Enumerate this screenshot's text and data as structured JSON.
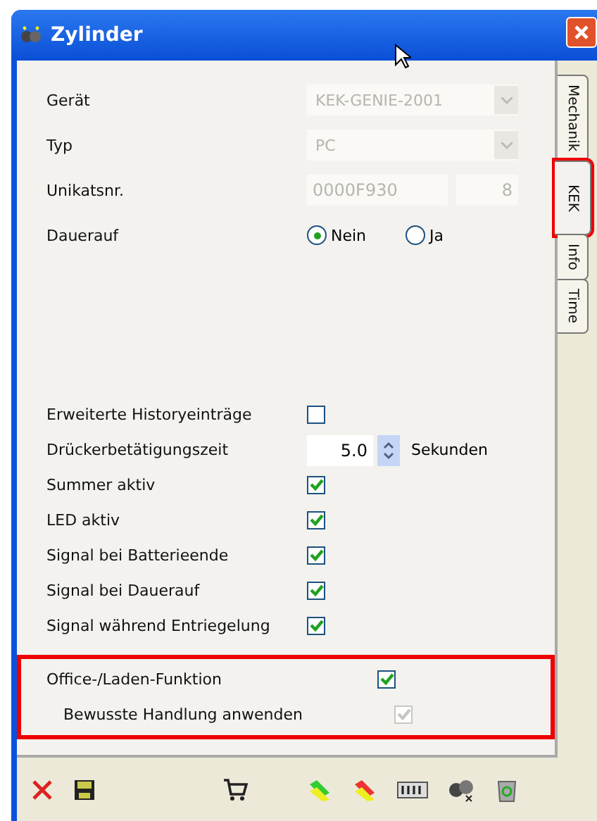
{
  "window": {
    "title": "Zylinder"
  },
  "tabs": [
    {
      "label": "Mechanik",
      "selected": false,
      "highlighted": false
    },
    {
      "label": "KEK",
      "selected": true,
      "highlighted": true
    },
    {
      "label": "Info",
      "selected": false,
      "highlighted": false
    },
    {
      "label": "Time",
      "selected": false,
      "highlighted": false
    }
  ],
  "device_fields": [
    {
      "kind": "combo",
      "label": "Gerät",
      "value": "KEK-GENIE-2001",
      "disabled": true
    },
    {
      "kind": "combo",
      "label": "Typ",
      "value": "PC",
      "disabled": true
    },
    {
      "kind": "pair",
      "label": "Unikatsnr.",
      "value": "0000F930",
      "value_2": "8",
      "disabled": true
    },
    {
      "kind": "radio",
      "label": "Dauerauf",
      "options": [
        {
          "label": "Nein",
          "selected": true
        },
        {
          "label": "Ja",
          "selected": false
        }
      ]
    }
  ],
  "options": [
    {
      "kind": "checkbox",
      "label": "Erweiterte Historyeinträge",
      "checked": false,
      "disabled": false
    },
    {
      "kind": "spinner",
      "label": "Drückerbetätigungszeit",
      "value": "5.0",
      "unit": "Sekunden"
    },
    {
      "kind": "checkbox",
      "label": "Summer aktiv",
      "checked": true,
      "disabled": false
    },
    {
      "kind": "checkbox",
      "label": "LED aktiv",
      "checked": true,
      "disabled": false
    },
    {
      "kind": "checkbox",
      "label": "Signal bei Batterieende",
      "checked": true,
      "disabled": false
    },
    {
      "kind": "checkbox",
      "label": "Signal bei Dauerauf",
      "checked": true,
      "disabled": false
    },
    {
      "kind": "checkbox",
      "label": "Signal während Entriegelung",
      "checked": true,
      "disabled": false
    }
  ],
  "office_group": {
    "highlighted": true,
    "items": [
      {
        "label": "Office-/Laden-Funktion",
        "checked": true,
        "disabled": false,
        "indented": false
      },
      {
        "label": "Bewusste Handlung anwenden",
        "checked": true,
        "disabled": true,
        "indented": true
      }
    ]
  },
  "toolbar": [
    {
      "kind": "delete"
    },
    {
      "kind": "save"
    },
    {
      "kind": "cart"
    },
    {
      "kind": "sync-green"
    },
    {
      "kind": "sync-red"
    },
    {
      "kind": "counter"
    },
    {
      "kind": "cylinders"
    },
    {
      "kind": "recycle"
    }
  ]
}
